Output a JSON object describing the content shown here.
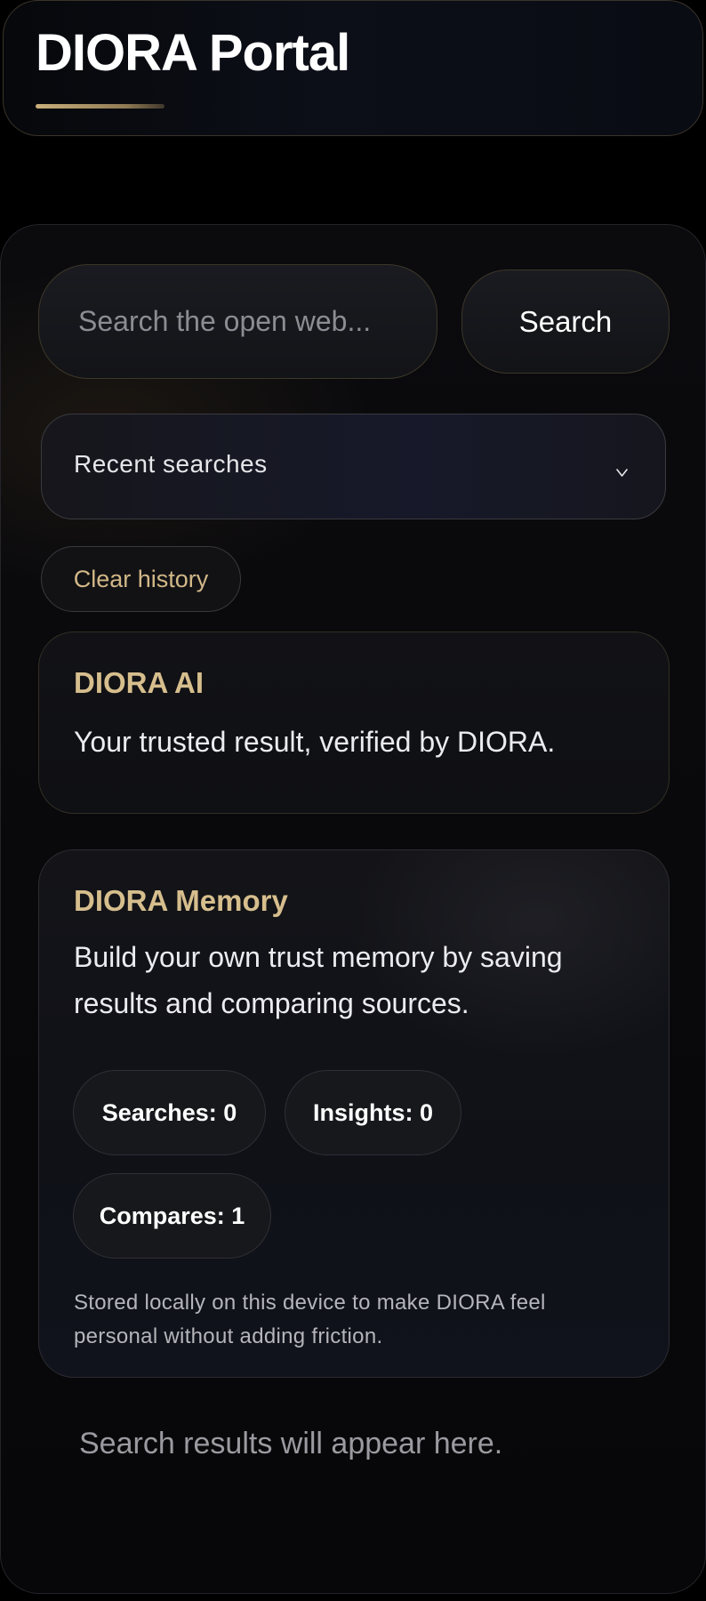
{
  "header": {
    "title": "DIORA Portal"
  },
  "search": {
    "placeholder": "Search the open web...",
    "button_label": "Search"
  },
  "recent_searches": {
    "label": "Recent searches",
    "icon": "chevron-down-icon"
  },
  "clear_history": {
    "label": "Clear history"
  },
  "ai_card": {
    "title": "DIORA AI",
    "text": "Your trusted result, verified by DIORA."
  },
  "memory_card": {
    "title": "DIORA Memory",
    "text_line1": "Build your own trust memory by saving",
    "text_line2": "results and comparing sources.",
    "stats": {
      "searches": "Searches: 0",
      "insights": "Insights: 0",
      "compares": "Compares: 1"
    },
    "note_line1": "Stored locally on this device to make DIORA feel",
    "note_line2": "personal without adding friction."
  },
  "results": {
    "placeholder": "Search results will appear here."
  },
  "colors": {
    "accent_gold": "#d6be8d",
    "background": "#000000",
    "text_primary": "#ffffff"
  }
}
